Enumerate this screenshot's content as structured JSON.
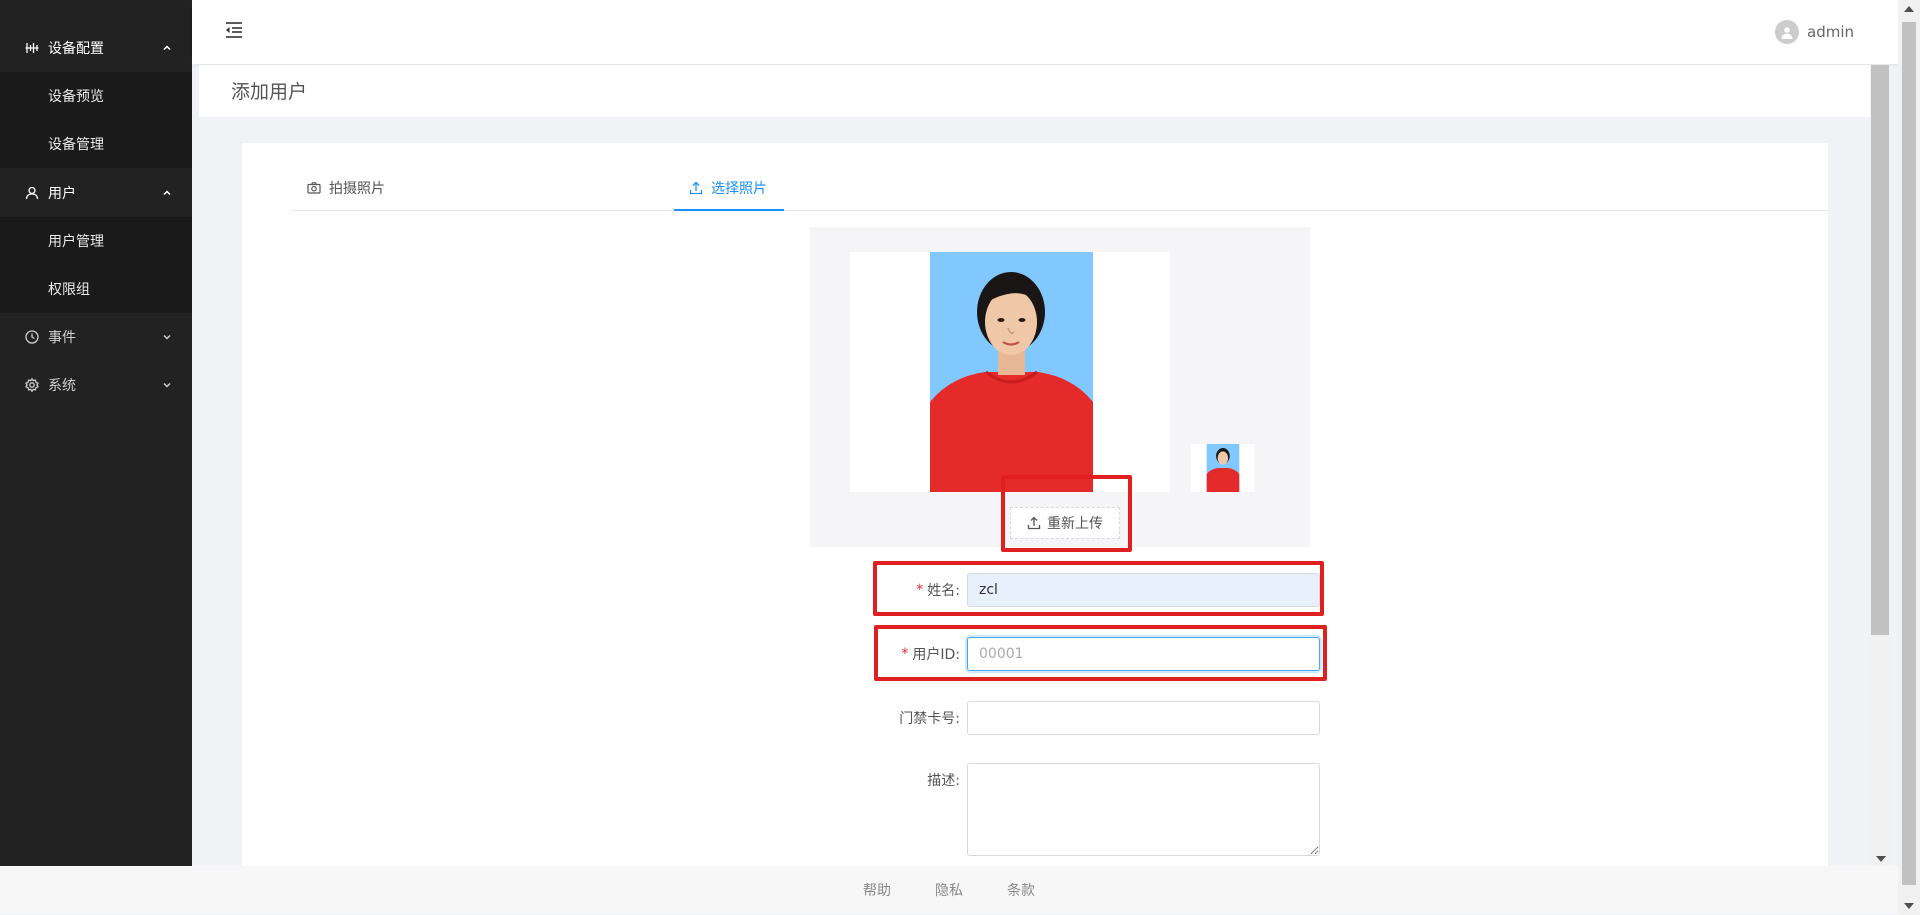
{
  "sidebar": {
    "groups": [
      {
        "label": "设备配置",
        "icon": "equalizer-icon",
        "expanded": true,
        "items": [
          {
            "label": "设备预览"
          },
          {
            "label": "设备管理"
          }
        ]
      },
      {
        "label": "用户",
        "icon": "user-icon",
        "expanded": true,
        "items": [
          {
            "label": "用户管理"
          },
          {
            "label": "权限组"
          }
        ]
      },
      {
        "label": "事件",
        "icon": "clock-icon",
        "expanded": false,
        "items": []
      },
      {
        "label": "系统",
        "icon": "gear-icon",
        "expanded": false,
        "items": []
      }
    ]
  },
  "header": {
    "menu_toggle_icon": "menu-fold-icon",
    "user": {
      "name": "admin",
      "avatar_icon": "user-avatar-icon"
    }
  },
  "page": {
    "title": "添加用户"
  },
  "tabs": [
    {
      "label": "拍摄照片",
      "icon": "camera-icon",
      "active": false
    },
    {
      "label": "选择照片",
      "icon": "upload-icon",
      "active": true
    }
  ],
  "photo": {
    "reupload_label": "重新上传",
    "reupload_icon": "upload-icon"
  },
  "form": {
    "name": {
      "label": "姓名:",
      "required": true,
      "value": "zcl"
    },
    "user_id": {
      "label": "用户ID:",
      "required": true,
      "placeholder": "00001"
    },
    "card_no": {
      "label": "门禁卡号:",
      "required": false,
      "value": ""
    },
    "description": {
      "label": "描述:",
      "required": false,
      "value": ""
    }
  },
  "footer": {
    "links": [
      "帮助",
      "隐私",
      "条款"
    ]
  },
  "colors": {
    "primary": "#1890ff",
    "sidebar_bg": "#222222",
    "highlight": "#e02020",
    "required": "#f5222d"
  }
}
